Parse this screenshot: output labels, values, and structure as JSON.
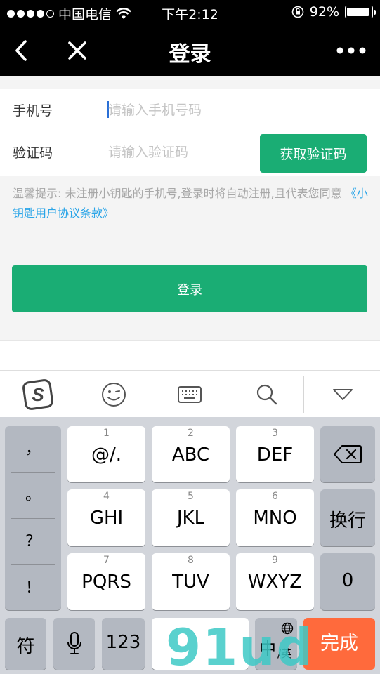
{
  "status_bar": {
    "carrier": "中国电信",
    "time": "下午2:12",
    "battery_percent": 92,
    "battery_label": "92%",
    "signal_bars": 4
  },
  "nav": {
    "title": "登录",
    "back_icon": "chevron-left-icon",
    "close_icon": "close-icon",
    "more_icon": "more-icon"
  },
  "form": {
    "phone": {
      "label": "手机号",
      "placeholder": "请输入手机号码",
      "value": ""
    },
    "code": {
      "label": "验证码",
      "placeholder": "请输入验证码",
      "value": "",
      "button": "获取验证码"
    }
  },
  "tip": {
    "text": "温馨提示: 未注册小钥匙的手机号,登录时将自动注册,且代表您同意",
    "link": "《小钥匙用户协议条款》"
  },
  "login_button": "登录",
  "keyboard": {
    "toolbar": [
      "sogou-logo-icon",
      "emoji-icon",
      "keyboard-icon",
      "search-icon",
      "collapse-icon"
    ],
    "punctuation": [
      "，",
      "。",
      "？",
      "！"
    ],
    "keys": [
      {
        "num": "1",
        "label": "@/."
      },
      {
        "num": "2",
        "label": "ABC"
      },
      {
        "num": "3",
        "label": "DEF"
      },
      {
        "num": "4",
        "label": "GHI"
      },
      {
        "num": "5",
        "label": "JKL"
      },
      {
        "num": "6",
        "label": "MNO"
      },
      {
        "num": "7",
        "label": "PQRS"
      },
      {
        "num": "8",
        "label": "TUV"
      },
      {
        "num": "9",
        "label": "WXYZ"
      }
    ],
    "newline": "换行",
    "zero": "0",
    "symbols": "符",
    "num123": "123",
    "lang_zh": "中",
    "lang_en": "/英",
    "done": "完成"
  },
  "watermark": "91ud"
}
